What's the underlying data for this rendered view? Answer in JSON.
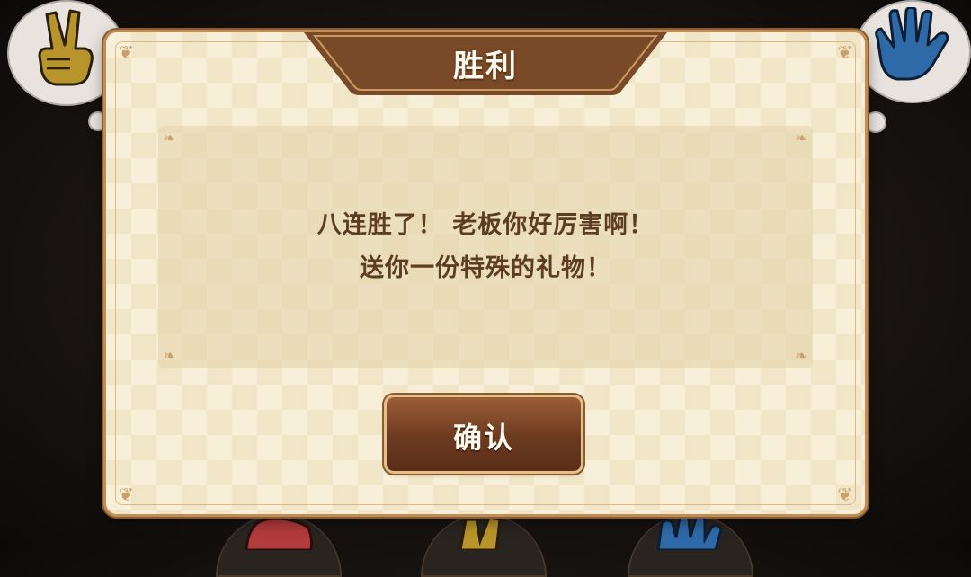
{
  "dialog": {
    "title": "胜利",
    "message_line1": "八连胜了！ 老板你好厉害啊！",
    "message_line2": "送你一份特殊的礼物！",
    "confirm_label": "确认"
  },
  "background": {
    "left_hand": "scissors-hand-icon",
    "right_hand": "paper-hand-icon",
    "bottom_hands": [
      "rock-hand-icon",
      "scissors-hand-icon",
      "paper-hand-icon"
    ]
  },
  "colors": {
    "dialog_bg": "#f7efd8",
    "banner_brown": "#7a4a28",
    "button_brown": "#6c3a1f",
    "text_brown": "#5c3d22",
    "hand_olive": "#b8952a",
    "hand_blue": "#2f6aa8",
    "hand_red": "#b23b3b"
  }
}
